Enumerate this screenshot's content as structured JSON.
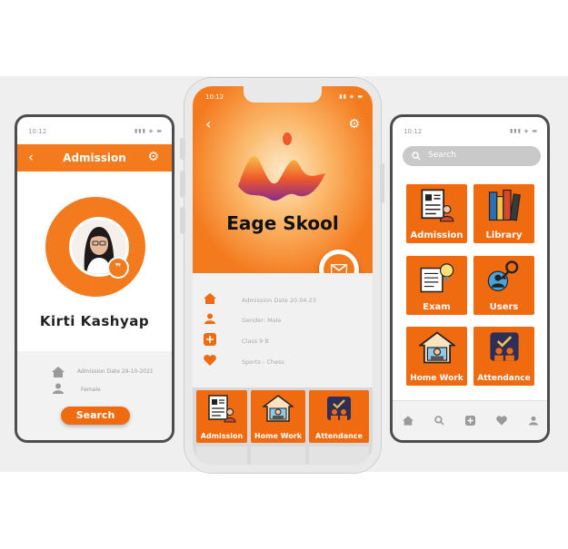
{
  "left": {
    "time": "10:12",
    "header_title": "Admission",
    "student_name": "Kirti Kashyap",
    "admission_date": "Admission Date 29-10-2021",
    "gender": "Female",
    "search_button": "Search"
  },
  "center": {
    "time": "10:12",
    "school_name": "Eage Skool",
    "info": [
      {
        "icon": "home-icon",
        "text": "Admission Date 20.04.23"
      },
      {
        "icon": "person-icon",
        "text": "Gender: Male"
      },
      {
        "icon": "plus-icon",
        "text": "Class 9 B"
      },
      {
        "icon": "heart-icon",
        "text": "Sports - Chess"
      }
    ],
    "tiles": [
      "Admission",
      "Home Work",
      "Attendance"
    ]
  },
  "right": {
    "time": "10:12",
    "search_placeholder": "Search",
    "tiles": [
      "Admission",
      "Library",
      "Exam",
      "Users",
      "Home Work",
      "Attendance"
    ],
    "nav": [
      "home-icon",
      "search-icon",
      "plus-icon",
      "heart-icon",
      "user-icon"
    ]
  },
  "colors": {
    "accent": "#f47a1e",
    "tile": "#f06b10",
    "light_bg": "#efefef"
  }
}
